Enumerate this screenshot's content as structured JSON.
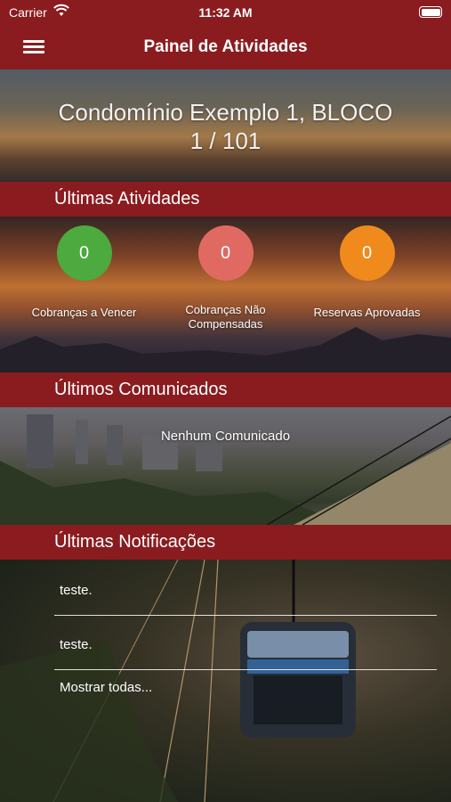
{
  "status_bar": {
    "carrier": "Carrier",
    "time": "11:32 AM"
  },
  "nav": {
    "title": "Painel de Atividades",
    "menu_icon": "hamburger-menu-icon"
  },
  "condo": {
    "line1": "Condomínio Exemplo 1, BLOCO",
    "line2": "1 / 101"
  },
  "activities": {
    "header": "Últimas Atividades",
    "items": [
      {
        "count": "0",
        "label_line1": "Cobranças a Vencer",
        "label_line2": "",
        "color": "#4caa3f"
      },
      {
        "count": "0",
        "label_line1": "Cobranças Não",
        "label_line2": "Compensadas",
        "color": "#e06a62"
      },
      {
        "count": "0",
        "label_line1": "Reservas Aprovadas",
        "label_line2": "",
        "color": "#f08a1c"
      }
    ]
  },
  "announcements": {
    "header": "Últimos Comunicados",
    "empty_message": "Nenhum Comunicado"
  },
  "notifications": {
    "header": "Últimas Notificações",
    "items": [
      "teste.",
      "teste."
    ],
    "show_all": "Mostrar todas..."
  },
  "colors": {
    "bar": "#8a1c1f"
  }
}
